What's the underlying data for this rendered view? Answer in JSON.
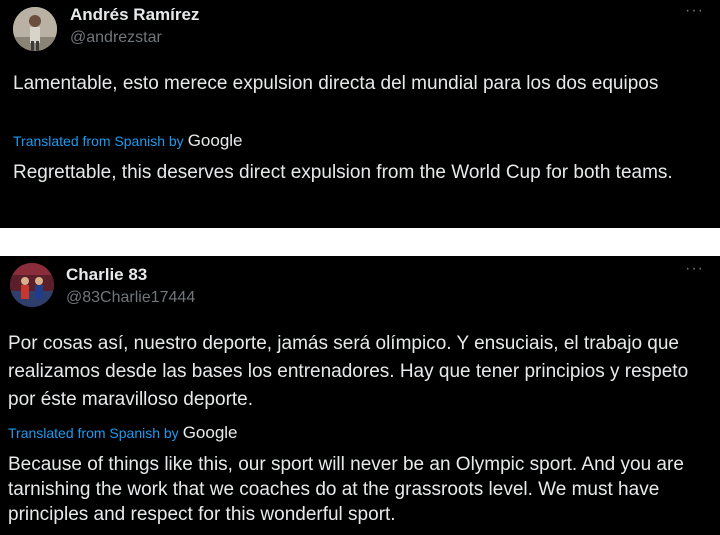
{
  "tweets": [
    {
      "display_name": "Andrés Ramírez",
      "handle": "@andrezstar",
      "more_icon": "more-horizontal-icon",
      "original_text": "Lamentable, esto merece expulsion directa del mundial para los dos equipos",
      "translated_label": "Translated from Spanish by",
      "translator": "Google",
      "translated_text": "Regrettable, this deserves direct expulsion from the World Cup for both teams."
    },
    {
      "display_name": "Charlie 83",
      "handle": "@83Charlie17444",
      "more_icon": "more-horizontal-icon",
      "original_text": "Por cosas así, nuestro deporte, jamás será olímpico. Y ensuciais, el trabajo que realizamos desde las bases los entrenadores. Hay que tener principios y respeto por éste maravilloso deporte.",
      "translated_label": "Translated from Spanish by",
      "translator": "Google",
      "translated_text": "Because of things like this, our sport will never be an Olympic sport. And you are tarnishing the work that we coaches do at the grassroots level. We must have principles and respect for this wonderful sport."
    }
  ],
  "colors": {
    "background": "#000000",
    "text": "#e7e9ea",
    "muted": "#71767b",
    "link": "#1d9bf0"
  }
}
